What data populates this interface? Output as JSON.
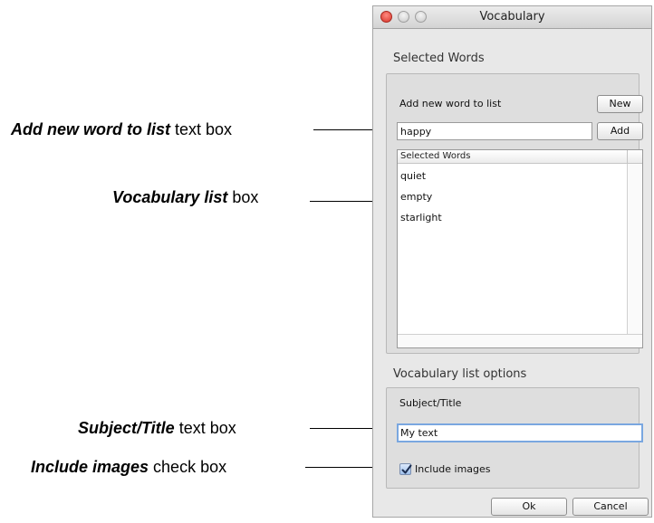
{
  "annotations": [
    {
      "bold": "Add new word to list",
      "rest": " text box"
    },
    {
      "bold": "Vocabulary list",
      "rest": " box"
    },
    {
      "bold": "Subject/Title",
      "rest": " text box"
    },
    {
      "bold": "Include images",
      "rest": " check box"
    }
  ],
  "window": {
    "title": "Vocabulary",
    "selected_words_section": {
      "title": "Selected Words",
      "add_label": "Add new word to list",
      "new_button": "New",
      "add_button": "Add",
      "word_input_value": "happy",
      "list_header": "Selected Words",
      "words": [
        "quiet",
        "empty",
        "starlight"
      ]
    },
    "options_section": {
      "title": "Vocabulary list options",
      "subject_label": "Subject/Title",
      "subject_value": "My text",
      "include_images_label": "Include images",
      "include_images_checked": true
    },
    "ok_button": "Ok",
    "cancel_button": "Cancel"
  }
}
